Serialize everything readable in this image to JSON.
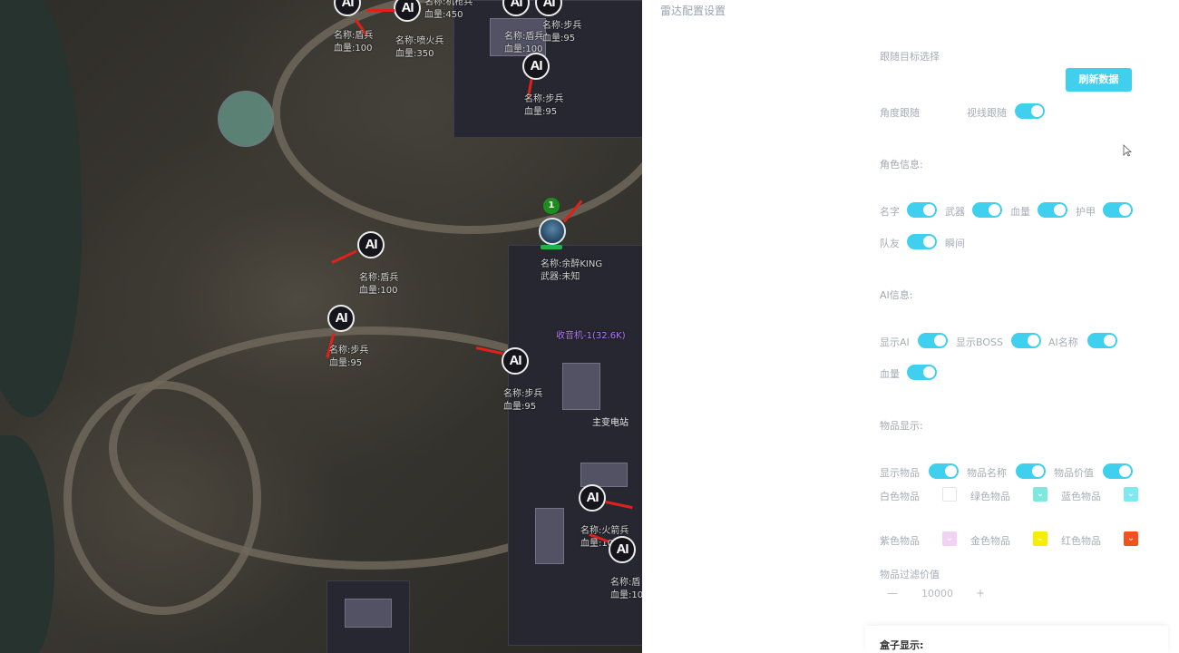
{
  "map": {
    "ai_units": [
      {
        "marker": "AI",
        "name": "",
        "hp": ""
      },
      {
        "marker": "AI",
        "name": "名称:机枪兵",
        "hp": "血量:450"
      },
      {
        "marker": "AI",
        "name": "名称:盾兵",
        "hp": "血量:100"
      },
      {
        "marker": "AI",
        "name": "名称:喷火兵",
        "hp": "血量:350"
      },
      {
        "marker": "AI",
        "name": "名称:盾兵",
        "hp": "血量:100"
      },
      {
        "marker": "AI",
        "name": "名称:步兵",
        "hp": "血量:95"
      },
      {
        "marker": "AI",
        "name": "名称:步兵",
        "hp": "血量:95"
      },
      {
        "marker": "AI",
        "name": "名称:盾兵",
        "hp": "血量:100"
      },
      {
        "marker": "AI",
        "name": "名称:步兵",
        "hp": "血量:95"
      },
      {
        "marker": "AI",
        "name": "名称:步兵",
        "hp": "血量:95"
      },
      {
        "marker": "AI",
        "name": "名称:火箭兵",
        "hp": "血量:10"
      },
      {
        "marker": "AI",
        "name": "名称:盾",
        "hp": "血量:10"
      }
    ],
    "player": {
      "badge": "1",
      "name": "名称:余醉KING",
      "weapon": "武器:未知"
    },
    "radio": "收音机-1(32.6K)",
    "poi": "主变电站"
  },
  "panel": {
    "title": "雷达配置设置",
    "follow_target_label": "跟随目标选择",
    "refresh_button": "刷新数据",
    "angle_follow_label": "角度跟随",
    "view_follow_label": "视线跟随",
    "char_info_title": "角色信息:",
    "char_toggles": [
      "名字",
      "武器",
      "血量",
      "护甲"
    ],
    "teammate_label": "队友",
    "quick_label": "瞬间",
    "ai_info_title": "AI信息:",
    "ai_toggles": [
      "显示AI",
      "显示BOSS",
      "AI名称"
    ],
    "ai_hp_label": "血量",
    "item_display_title": "物品显示:",
    "item_toggles": [
      "显示物品",
      "物品名称",
      "物品价值"
    ],
    "item_colors": [
      {
        "label": "白色物品",
        "color": "#ffffff"
      },
      {
        "label": "绿色物品",
        "color": "#7fe8de"
      },
      {
        "label": "蓝色物品",
        "color": "#7fe8f0"
      },
      {
        "label": "紫色物品",
        "color": "#f1d2f5"
      },
      {
        "label": "金色物品",
        "color": "#f5ee00"
      },
      {
        "label": "红色物品",
        "color": "#f1531a"
      }
    ],
    "item_filter_label": "物品过滤价值",
    "stepper": {
      "minus": "—",
      "value": "10000",
      "plus": "+"
    },
    "box_display_title": "盒子显示:"
  },
  "colors": {
    "accent": "#40d0ee",
    "danger_line": "#e0211b",
    "radio": "#b57cff"
  }
}
